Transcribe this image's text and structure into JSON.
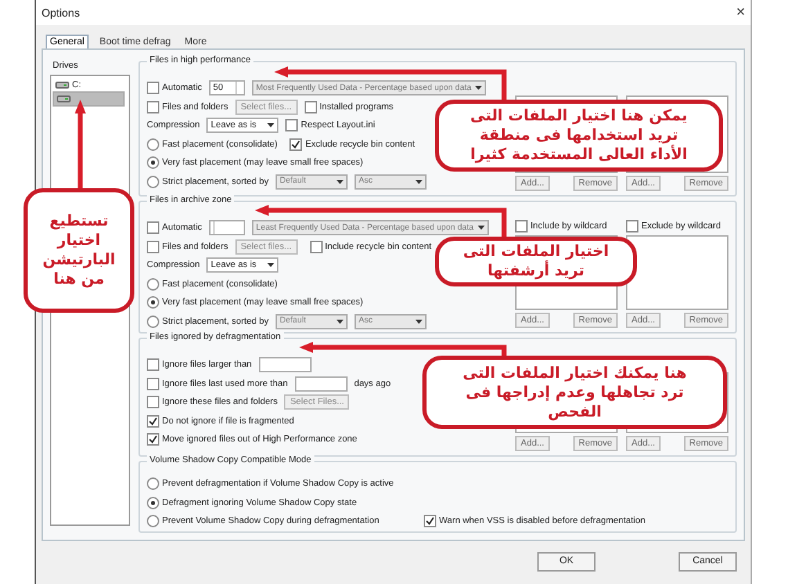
{
  "window": {
    "title": "Options",
    "close": "×"
  },
  "tabs": [
    {
      "label": "General",
      "selected": true
    },
    {
      "label": "Boot time defrag",
      "selected": false
    },
    {
      "label": "More",
      "selected": false
    }
  ],
  "drives": {
    "label": "Drives",
    "items": [
      {
        "label": "C:",
        "selected": false
      },
      {
        "selected": true
      }
    ],
    "annotation": {
      "text": "تستطيع\nاختيار\nالبارتيشن\nمن هنا"
    }
  },
  "groups": [
    {
      "title": "Files in high performance",
      "annotation": {
        "text": "يمكن هنا اختيار الملفات التى\nتريد استخدامها فى منطقة\nالأداء العالى المستخدمة كثيرا"
      },
      "lines": [
        {
          "controls": [
            {
              "kind": "checkbox",
              "label": "Automatic",
              "checked": false
            },
            {
              "kind": "spin",
              "value": "50"
            },
            {
              "kind": "select",
              "value": "Most Frequently Used Data - Percentage based upon data",
              "disabled": true
            }
          ]
        },
        {
          "controls": [
            {
              "kind": "checkbox",
              "label": "Files and folders",
              "checked": false
            },
            {
              "kind": "button",
              "label": "Select files...",
              "disabled": true
            },
            {
              "kind": "checkbox",
              "label": "Installed programs",
              "checked": false
            }
          ]
        },
        {
          "controls": [
            {
              "kind": "text",
              "label": "Compression"
            },
            {
              "kind": "select",
              "value": "Leave as is",
              "disabled": false
            },
            {
              "kind": "checkbox",
              "label": "Respect Layout.ini",
              "checked": false
            }
          ]
        },
        {
          "controls": [
            {
              "kind": "radio",
              "label": "Fast placement (consolidate)",
              "selected": false
            },
            {
              "kind": "checkbox",
              "label": "Exclude recycle bin content",
              "checked": true
            }
          ]
        },
        {
          "controls": [
            {
              "kind": "radio",
              "label": "Very fast placement (may leave small free spaces)",
              "selected": true
            }
          ]
        },
        {
          "controls": [
            {
              "kind": "radio",
              "label": "Strict placement, sorted by",
              "selected": false
            },
            {
              "kind": "select",
              "value": "Default",
              "disabled": true
            },
            {
              "kind": "select",
              "value": "Asc",
              "disabled": true
            }
          ]
        }
      ],
      "wildcards": [
        {
          "buttons": [
            "Add...",
            "Remove"
          ]
        },
        {
          "buttons": [
            "Add...",
            "Remove"
          ]
        }
      ]
    },
    {
      "title": "Files in archive zone",
      "annotation": {
        "text": "اختيار الملفات التى\nتريد أرشفتها"
      },
      "lines": [
        {
          "controls": [
            {
              "kind": "checkbox",
              "label": "Automatic",
              "checked": false
            },
            {
              "kind": "spin"
            },
            {
              "kind": "select",
              "value": "Least Frequently Used Data - Percentage based upon data",
              "disabled": true
            }
          ]
        },
        {
          "controls": [
            {
              "kind": "checkbox",
              "label": "Files and folders",
              "checked": false
            },
            {
              "kind": "button",
              "label": "Select files...",
              "disabled": true
            },
            {
              "kind": "checkbox",
              "label": "Include recycle bin content",
              "checked": false
            }
          ]
        },
        {
          "controls": [
            {
              "kind": "text",
              "label": "Compression"
            },
            {
              "kind": "select",
              "value": "Leave as is",
              "disabled": false
            }
          ]
        },
        {
          "controls": [
            {
              "kind": "radio",
              "label": "Fast placement (consolidate)",
              "selected": false
            }
          ]
        },
        {
          "controls": [
            {
              "kind": "radio",
              "label": "Very fast placement (may leave small free spaces)",
              "selected": true
            }
          ]
        },
        {
          "controls": [
            {
              "kind": "radio",
              "label": "Strict placement, sorted by",
              "selected": false
            },
            {
              "kind": "select",
              "value": "Default",
              "disabled": true
            },
            {
              "kind": "select",
              "value": "Asc",
              "disabled": true
            }
          ]
        }
      ],
      "wildcards": [
        {
          "label": "Include by wildcard",
          "checked": false,
          "buttons": [
            "Add...",
            "Remove"
          ]
        },
        {
          "label": "Exclude by wildcard",
          "checked": false,
          "buttons": [
            "Add...",
            "Remove"
          ]
        }
      ]
    },
    {
      "title": "Files ignored by defragmentation",
      "annotation": {
        "text": "هنا يمكنك اختيار الملفات التى\nترد تجاهلها وعدم إدراجها فى\nالفحص"
      },
      "lines": [
        {
          "controls": [
            {
              "kind": "checkbox",
              "label": "Ignore files larger than",
              "checked": false
            },
            {
              "kind": "field"
            }
          ]
        },
        {
          "controls": [
            {
              "kind": "checkbox",
              "label": "Ignore files last used more than",
              "checked": false
            },
            {
              "kind": "field"
            },
            {
              "kind": "text",
              "label": "days ago"
            }
          ]
        },
        {
          "controls": [
            {
              "kind": "checkbox",
              "label": "Ignore these files and folders",
              "checked": false
            },
            {
              "kind": "button",
              "label": "Select Files...",
              "disabled": true
            }
          ]
        },
        {
          "controls": [
            {
              "kind": "checkbox",
              "label": "Do not ignore if file is fragmented",
              "checked": true
            }
          ]
        },
        {
          "controls": [
            {
              "kind": "checkbox",
              "label": "Move ignored files out of High Performance zone",
              "checked": true
            }
          ]
        }
      ],
      "wildcards": [
        {
          "buttons": [
            "Add...",
            "Remove"
          ]
        },
        {
          "buttons": [
            "Add...",
            "Remove"
          ]
        }
      ]
    },
    {
      "title": "Volume Shadow Copy Compatible Mode",
      "lines": [
        {
          "controls": [
            {
              "kind": "radio",
              "label": "Prevent defragmentation if Volume Shadow Copy is active",
              "selected": false
            }
          ]
        },
        {
          "controls": [
            {
              "kind": "radio",
              "label": "Defragment ignoring Volume Shadow Copy state",
              "selected": true
            }
          ]
        },
        {
          "controls": [
            {
              "kind": "radio",
              "label": "Prevent Volume Shadow Copy during defragmentation",
              "selected": false
            },
            {
              "kind": "checkbox",
              "label": "Warn when VSS is disabled before defragmentation",
              "checked": true
            }
          ]
        }
      ]
    }
  ],
  "buttons": [
    {
      "label": "OK"
    },
    {
      "label": "Cancel"
    }
  ]
}
